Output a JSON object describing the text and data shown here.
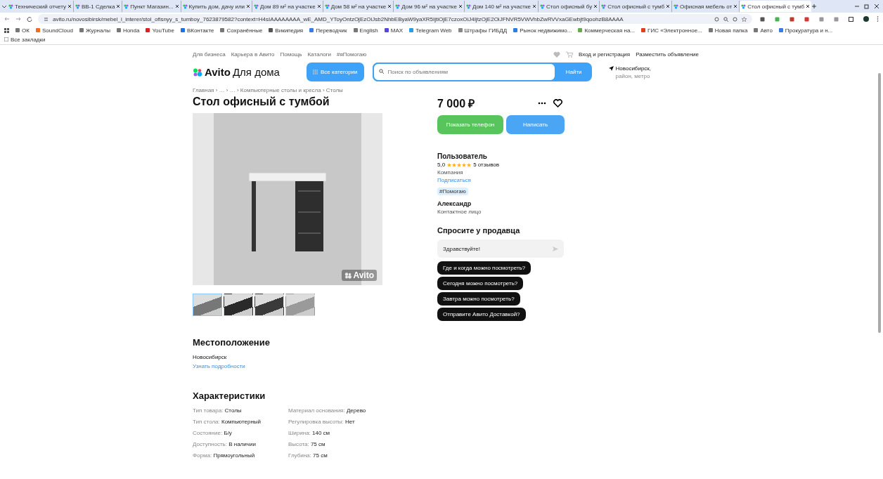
{
  "browser": {
    "tabs": [
      {
        "title": "Технический отчету",
        "selected": false
      },
      {
        "title": "ВВ-1 Сделка",
        "selected": false
      },
      {
        "title": "Пункт Магазин...",
        "selected": false
      },
      {
        "title": "Купить дом, дачу или",
        "selected": false
      },
      {
        "title": "Дом 89 м² на участке",
        "selected": false
      },
      {
        "title": "Дом 58 м² на участке",
        "selected": false
      },
      {
        "title": "Дом 96 м² на участке",
        "selected": false
      },
      {
        "title": "Дом 140 м² на участке",
        "selected": false
      },
      {
        "title": "Стол офисный бу",
        "selected": false
      },
      {
        "title": "Стол офисный с тумб",
        "selected": false
      },
      {
        "title": "Офисная мебель от",
        "selected": false
      },
      {
        "title": "Стол офисный с тумб",
        "selected": true
      }
    ],
    "address": "avito.ru/novosibirsk/mebel_i_interer/stol_ofisnyy_s_tumboy_7623879582?context=H4sIAAAAAAAA_wE_AMD_YToyOntzOjEzOiJsb2NhbEByaW9yaXR5IjtiOjE7czoxOiJ4IjtzOjE2OiJFNVR5VWVhbZwRVVxaGEwbjt9qoohzB8AAAA",
    "bookmarks": [
      "ОК",
      "SoundCloud",
      "Журналы",
      "Honda",
      "YouTube",
      "ВКонтакте",
      "Сохранённые",
      "Википедия",
      "Переводчик",
      "English",
      "MAX",
      "Telegram Web",
      "Штрафы ГИБДД",
      "Рынок недвижимо...",
      "Коммерческая на...",
      "ГИС «Электронное...",
      "Новая папка",
      "Авто",
      "Прокуратура и н..."
    ],
    "all_bookmarks": "Все закладки"
  },
  "top_nav": {
    "links": [
      "Для бизнеса",
      "Карьера в Авито",
      "Помощь",
      "Каталоги",
      "#яПомогаю"
    ],
    "login": "Вход и регистрация",
    "post_ad": "Разместить объявление"
  },
  "header": {
    "logo": "Avito",
    "logo_suffix": "Для дома",
    "categories_button": "Все категории",
    "search": {
      "placeholder": "Поиск по объявлениям"
    },
    "find_button": "Найти",
    "location": "Новосибирск,",
    "location_sub": "район, метро"
  },
  "breadcrumbs": "Главная › … › … › Компьютерные столы и кресла › Столы",
  "title": "Стол офисный с тумбой",
  "gallery": {
    "watermark_logo": "Avito",
    "thumbnails": [
      {
        "selected": true
      },
      {
        "selected": false
      },
      {
        "selected": false
      },
      {
        "selected": false
      }
    ]
  },
  "location": {
    "heading": "Местоположение",
    "city": "Новосибирск",
    "details_link": "Узнать подробности"
  },
  "specs": {
    "heading": "Характеристики",
    "columns": [
      [
        {
          "label": "Тип товара:",
          "value": "Столы"
        },
        {
          "label": "Тип стола:",
          "value": "Компьютерный"
        },
        {
          "label": "Состояние:",
          "value": "Б/у"
        },
        {
          "label": "Доступность:",
          "value": "В наличии"
        },
        {
          "label": "Форма:",
          "value": "Прямоугольный"
        }
      ],
      [
        {
          "label": "Материал основания:",
          "value": "Дерево"
        },
        {
          "label": "Регулировка высоты:",
          "value": "Нет"
        },
        {
          "label": "Ширина:",
          "value": "140 см"
        },
        {
          "label": "Высота:",
          "value": "75 см"
        },
        {
          "label": "Глубина:",
          "value": "75 см"
        }
      ]
    ]
  },
  "price": "7 000 ₽",
  "buttons": {
    "show_phone": "Показать телефон",
    "write": "Написать"
  },
  "seller": {
    "name": "Пользователь",
    "rating": "5,0",
    "stars": 5,
    "reviews": "5 отзывов",
    "type": "Компания",
    "subscribe": "Подписаться",
    "tag": "#Помогаю",
    "contact_name": "Александр",
    "contact_role": "Контактное лицо"
  },
  "ask": {
    "heading": "Спросите у продавца",
    "message": "Здравствуйте!",
    "quick_questions": [
      "Где и когда можно посмотреть?",
      "Сегодня можно посмотреть?",
      "Завтра можно посмотреть?",
      "Отправите Авито Доставкой?"
    ]
  }
}
